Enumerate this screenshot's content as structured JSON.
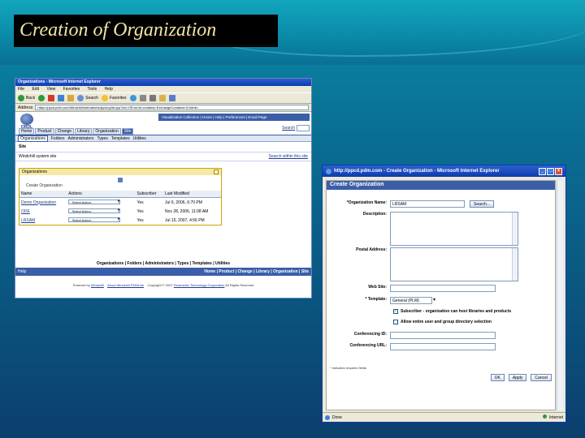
{
  "slide": {
    "title": "Creation of Organization"
  },
  "browser1": {
    "title": "Organizations - Microsoft Internet Explorer",
    "menu": [
      "File",
      "Edit",
      "View",
      "Favorites",
      "Tools",
      "Help"
    ],
    "toolbar": {
      "back": "Back",
      "search": "Search",
      "favorites": "Favorites"
    },
    "address_label": "Address",
    "address_value": "https://ppcd.pdm.com/Windchill/netmarkets/jsp/org/list.jsp?oid=OR:wt.inf.container.ExchangeContainer:5:Admin",
    "logo_text": "ORDL",
    "top_links": "Visualization Collection  |  Home  |  Help  |  Preferences  |  Email Page",
    "tabs": [
      "Home",
      "Product",
      "Change",
      "Library",
      "Organization",
      "Site"
    ],
    "search_label": "Search",
    "subnav": [
      "Organizations",
      "Folders",
      "Administrators",
      "Types",
      "Templates",
      "Utilities"
    ],
    "crumb": "Site",
    "site_name": "Windchill system site",
    "search_site": "Search within this site",
    "panel_title": "Organizations",
    "create_label": "Create Organization",
    "columns": [
      "Name",
      "Actions",
      "Subscriber",
      "Last Modified"
    ],
    "rows": [
      {
        "name": "Demo Organization",
        "action": "- Select Action -",
        "subscriber": "Yes",
        "modified": "Jul 6, 2006, 6:70 PM"
      },
      {
        "name": "ODE",
        "action": "- Select Action -",
        "subscriber": "Yes",
        "modified": "Nov 28, 2006, 11:08 AM"
      },
      {
        "name": "LRSAM",
        "action": "- Select Action -",
        "subscriber": "Yes",
        "modified": "Jul 15, 2007, 4:56 PM"
      }
    ],
    "footer_links": "Organizations | Folders | Administrators | Types | Templates | Utilities",
    "bottom_left": "Help",
    "bottom_links": "Home | Product | Change | Library | Organization | Site",
    "powered_by": "Powered by",
    "powered_link": "Windchill",
    "about_link": "About Windchill PDMLink",
    "copyright": "Copyright © 2007",
    "ptc_link": "Parametric Technology Corporation",
    "rights": "All Rights Reserved"
  },
  "browser2": {
    "title": "http://ppcd.pdm.com - Create Organization - Microsoft Internet Explorer",
    "dialog_title": "Create Organization",
    "org_name_label": "*Organization Name:",
    "org_name_value": "LRSAM",
    "search_button": "Search...",
    "description_label": "Description:",
    "postal_label": "Postal Address:",
    "website_label": "Web Site:",
    "template_label": "* Template:",
    "template_value": "General (PLM)",
    "subscriber_text": "Subscriber - organization can host libraries and products",
    "directory_text": "Allow entire user and group directory selection",
    "conf_id_label": "Conferencing ID:",
    "conf_url_label": "Conferencing URL:",
    "note": "* Indicates required fields",
    "ok": "OK",
    "apply": "Apply",
    "cancel": "Cancel",
    "status_left": "Done",
    "status_right": "Internet"
  },
  "colors": {
    "title_bg": "#000000",
    "title_text": "#f4e5a4",
    "xp_blue": "#0a3cae",
    "app_blue": "#3b5ea8"
  }
}
